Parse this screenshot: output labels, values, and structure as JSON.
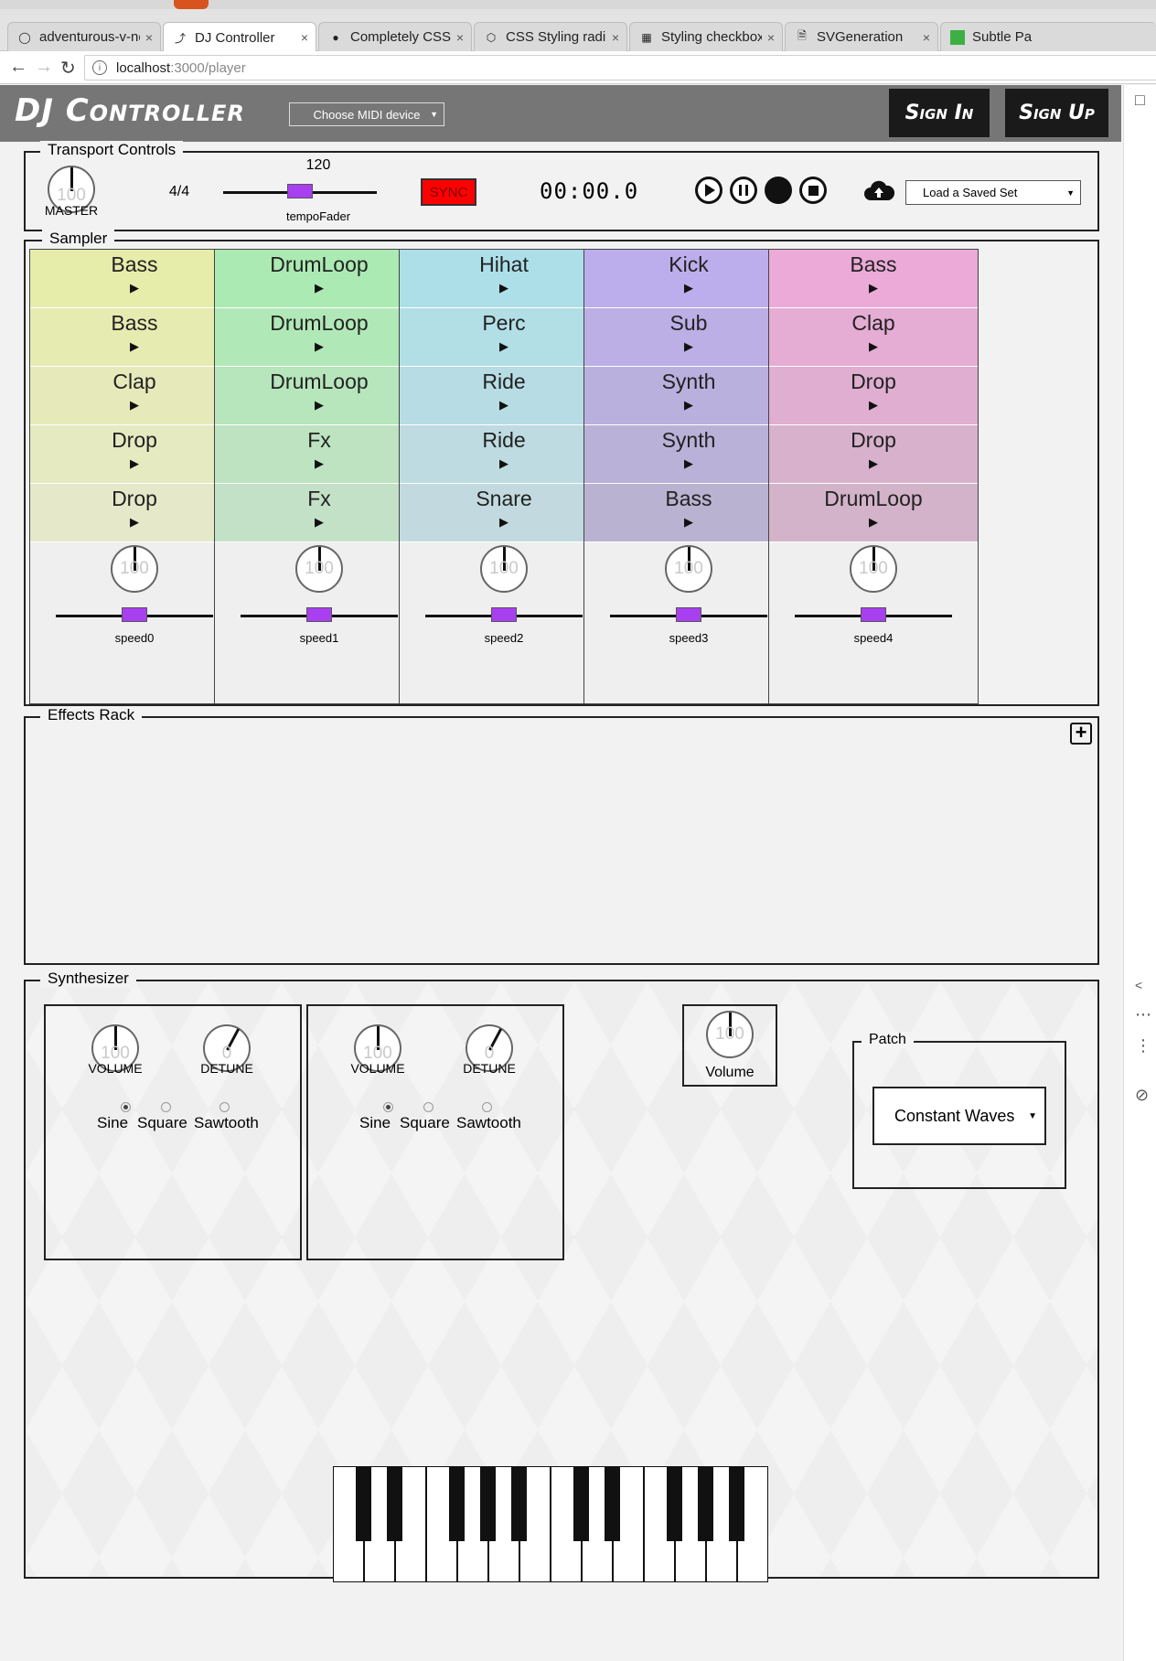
{
  "browser": {
    "tabs": [
      {
        "title": "adventurous-v-neck",
        "icon": "github-icon",
        "active": false
      },
      {
        "title": "DJ Controller",
        "icon": "page-icon",
        "active": true
      },
      {
        "title": "Completely CSS: Cu",
        "icon": "person-icon",
        "active": false
      },
      {
        "title": "CSS Styling radio bu",
        "icon": "codepen-icon",
        "active": false
      },
      {
        "title": "Styling checkboxes",
        "icon": "grid-icon",
        "active": false
      },
      {
        "title": "SVGeneration",
        "icon": "document-icon",
        "active": false
      },
      {
        "title": "Subtle Pa",
        "icon": "green-square-icon",
        "active": false
      }
    ],
    "url_host": "localhost",
    "url_path": ":3000/player"
  },
  "header": {
    "brand": "DJ Controller",
    "midi_select": "Choose MIDI device",
    "sign_in": "Sign In",
    "sign_up": "Sign Up"
  },
  "transport": {
    "legend": "Transport Controls",
    "master_value": "100",
    "master_label": "MASTER",
    "time_signature": "4/4",
    "tempo": "120",
    "tempo_label": "tempoFader",
    "tempo_fraction": 0.5,
    "sync": "SYNC",
    "clock": "00:00.0",
    "load_set": "Load a Saved Set"
  },
  "sampler": {
    "legend": "Sampler",
    "columns": [
      {
        "color": "#e6ecaa",
        "pads": [
          "Bass",
          "Bass",
          "Clap",
          "Drop",
          "Drop"
        ],
        "knob": "100",
        "speed": "speed0"
      },
      {
        "color": "#abeab2",
        "pads": [
          "DrumLoop",
          "DrumLoop",
          "DrumLoop",
          "Fx",
          "Fx"
        ],
        "knob": "100",
        "speed": "speed1"
      },
      {
        "color": "#addfe9",
        "pads": [
          "Hihat",
          "Perc",
          "Ride",
          "Ride",
          "Snare"
        ],
        "knob": "100",
        "speed": "speed2"
      },
      {
        "color": "#bcaeec",
        "pads": [
          "Kick",
          "Sub",
          "Synth",
          "Synth",
          "Bass"
        ],
        "knob": "100",
        "speed": "speed3"
      },
      {
        "color": "#ebaad8",
        "pads": [
          "Bass",
          "Clap",
          "Drop",
          "Drop",
          "DrumLoop"
        ],
        "knob": "100",
        "speed": "speed4"
      }
    ]
  },
  "effects": {
    "legend": "Effects Rack",
    "add_icon": "plus-box-icon"
  },
  "synth": {
    "legend": "Synthesizer",
    "oscillators": [
      {
        "volume_value": "100",
        "volume_label": "VOLUME",
        "detune_value": "0",
        "detune_label": "DETUNE",
        "waves": [
          "Sine",
          "Square",
          "Sawtooth"
        ],
        "selected": "Sine"
      },
      {
        "volume_value": "100",
        "volume_label": "VOLUME",
        "detune_value": "0",
        "detune_label": "DETUNE",
        "waves": [
          "Sine",
          "Square",
          "Sawtooth"
        ],
        "selected": "Sine"
      }
    ],
    "volume_value": "100",
    "volume_label": "Volume",
    "patch_legend": "Patch",
    "patch_value": "Constant Waves"
  }
}
